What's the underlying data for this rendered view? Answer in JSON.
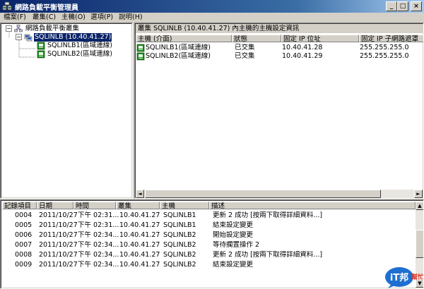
{
  "window": {
    "title": "網路負載平衡管理員",
    "min_label": "_",
    "max_label": "□",
    "close_label": "×"
  },
  "menu": [
    {
      "label": "檔案(F)"
    },
    {
      "label": "叢集(C)"
    },
    {
      "label": "主機(O)"
    },
    {
      "label": "選項(P)"
    },
    {
      "label": "說明(H)"
    }
  ],
  "tree": {
    "root_label": "網路負載平衡叢集",
    "cluster_label": "SQLINLB (10.40.41.27)",
    "hosts": [
      {
        "label": "SQLINLB1(區域連線)"
      },
      {
        "label": "SQLINLB2(區域連線)"
      }
    ],
    "collapse_symbol": "−"
  },
  "detail": {
    "caption": "叢集 SQLINLB (10.40.41.27) 內主機的主機設定資訊",
    "columns": [
      "主機 (介面)",
      "狀態",
      "固定 IP 位址",
      "固定 IP 子網路遮罩"
    ],
    "rows": [
      {
        "host": "SQLINLB1(區域連線)",
        "status": "已交集",
        "ip": "10.40.41.28",
        "mask": "255.255.255.0"
      },
      {
        "host": "SQLINLB2(區域連線)",
        "status": "已交集",
        "ip": "10.40.41.29",
        "mask": "255.255.255.0"
      }
    ]
  },
  "log": {
    "columns": [
      "記錄項目",
      "日期",
      "時間",
      "叢集",
      "主機",
      "描述"
    ],
    "rows": [
      {
        "entry": "0004",
        "date": "2011/10/27",
        "time": "下午 02:31...",
        "cluster": "10.40.41.27",
        "host": "SQLINLB1",
        "desc": "更新 2 成功 [按兩下取得詳細資料...]"
      },
      {
        "entry": "0005",
        "date": "2011/10/27",
        "time": "下午 02:31...",
        "cluster": "10.40.41.27",
        "host": "SQLINLB1",
        "desc": "結束設定變更"
      },
      {
        "entry": "0006",
        "date": "2011/10/27",
        "time": "下午 02:34...",
        "cluster": "10.40.41.27",
        "host": "SQLINLB2",
        "desc": "開始設定變更"
      },
      {
        "entry": "0007",
        "date": "2011/10/27",
        "time": "下午 02:34...",
        "cluster": "10.40.41.27",
        "host": "SQLINLB2",
        "desc": "等待擱置操作 2"
      },
      {
        "entry": "0008",
        "date": "2011/10/27",
        "time": "下午 02:34...",
        "cluster": "10.40.41.27",
        "host": "SQLINLB2",
        "desc": "更新 2 成功 [按兩下取得詳細資料...]"
      },
      {
        "entry": "0009",
        "date": "2011/10/27",
        "time": "下午 02:34...",
        "cluster": "10.40.41.27",
        "host": "SQLINLB2",
        "desc": "結束設定變更"
      }
    ]
  },
  "scroll": {
    "left": "◄",
    "right": "►",
    "up": "▲",
    "down": "▼"
  },
  "watermark": {
    "text_main": "iT邦",
    "text_sub": "幫忙",
    "colors": {
      "bubble": "#1f6fd0",
      "accent": "#e23a2a"
    }
  },
  "colors": {
    "selection": "#0a246a",
    "titlebar": "#0a246a",
    "face": "#d4d0c8"
  }
}
